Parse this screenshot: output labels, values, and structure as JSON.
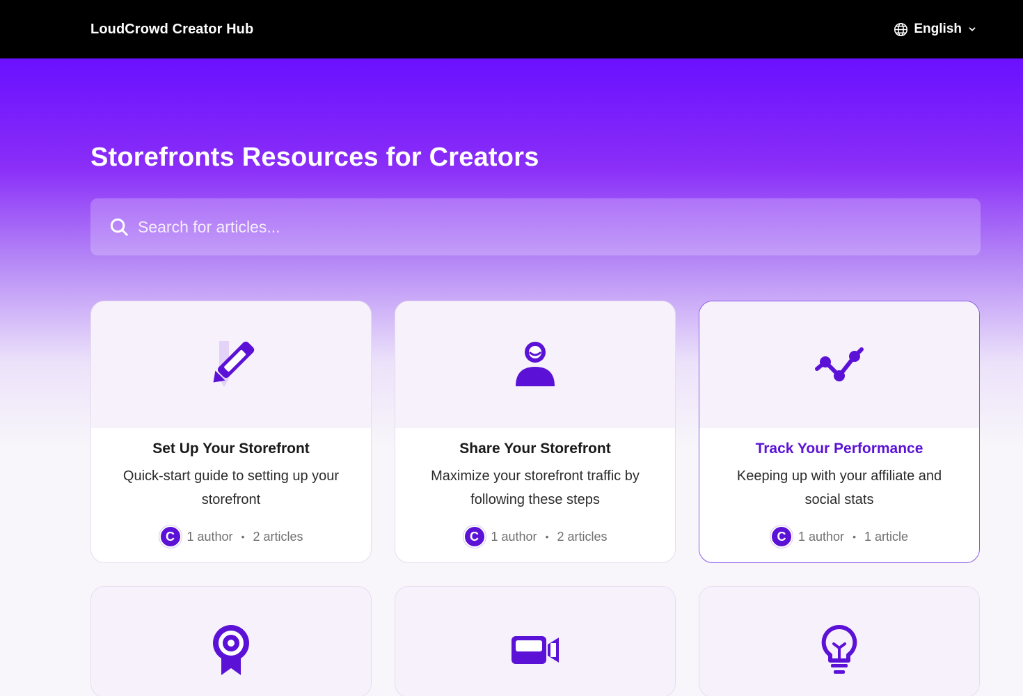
{
  "header": {
    "brand": "LoudCrowd Creator Hub",
    "language": "English"
  },
  "hero": {
    "title": "Storefronts Resources for Creators"
  },
  "search": {
    "placeholder": "Search for articles..."
  },
  "colors": {
    "accent": "#5b12d6",
    "hero_top": "#6a10ff"
  },
  "cards": [
    {
      "icon": "pencil-icon",
      "title": "Set Up Your Storefront",
      "description": "Quick-start guide to setting up your storefront",
      "author_initial": "C",
      "authors": "1 author",
      "articles": "2 articles"
    },
    {
      "icon": "person-icon",
      "title": "Share Your Storefront",
      "description": "Maximize your storefront traffic by following these steps",
      "author_initial": "C",
      "authors": "1 author",
      "articles": "2 articles"
    },
    {
      "icon": "line-chart-icon",
      "title": "Track Your Performance",
      "description": "Keeping up with your affiliate and social stats",
      "author_initial": "C",
      "authors": "1 author",
      "articles": "1 article"
    },
    {
      "icon": "award-icon"
    },
    {
      "icon": "video-camera-icon"
    },
    {
      "icon": "lightbulb-icon"
    }
  ]
}
